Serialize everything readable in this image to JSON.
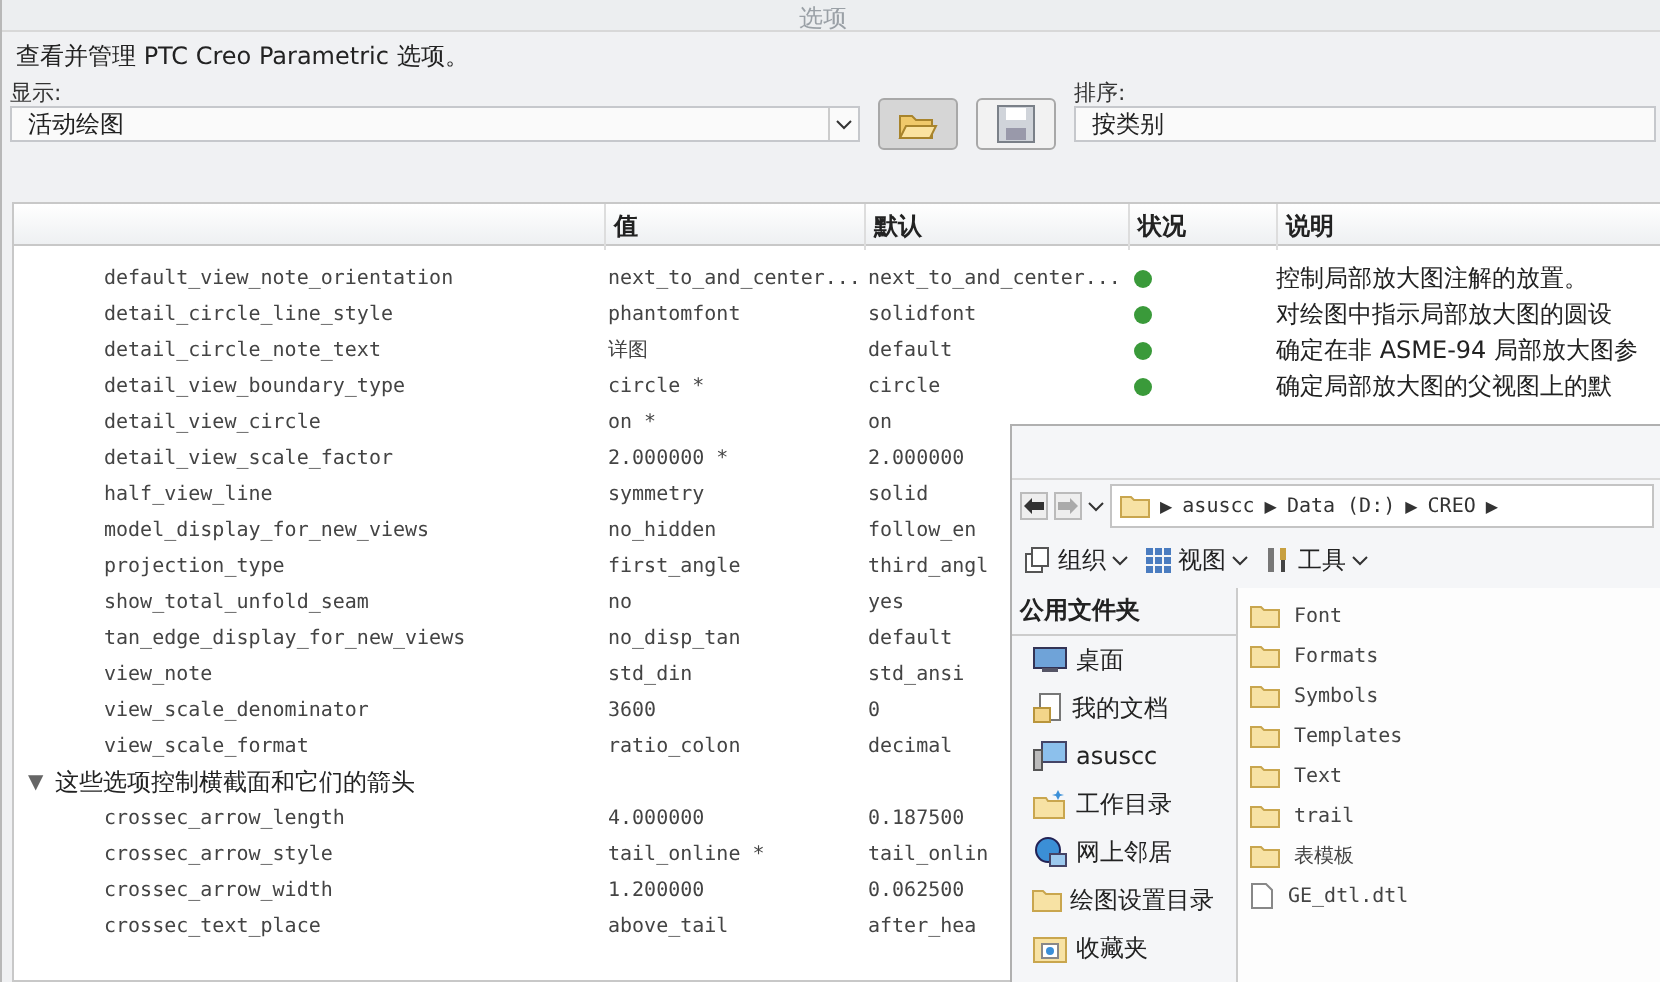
{
  "window": {
    "title": "选项"
  },
  "intro": "查看并管理 PTC Creo Parametric 选项。",
  "show": {
    "label": "显示:",
    "value": "活动绘图"
  },
  "sort": {
    "label": "排序:",
    "value": "按类别"
  },
  "table": {
    "columns": [
      "值",
      "默认",
      "状况",
      "说明"
    ],
    "rows": [
      {
        "kind": "option",
        "name": "default_view_note_orientation",
        "value": "next_to_and_center...",
        "default": "next_to_and_center...",
        "status": true,
        "description": "控制局部放大图注解的放置。"
      },
      {
        "kind": "option",
        "name": "detail_circle_line_style",
        "value": "phantomfont",
        "default": "solidfont",
        "status": true,
        "description": "对绘图中指示局部放大图的圆设"
      },
      {
        "kind": "option",
        "name": "detail_circle_note_text",
        "value": "详图",
        "default": "default",
        "status": true,
        "description": "确定在非 ASME-94 局部放大图参"
      },
      {
        "kind": "option",
        "name": "detail_view_boundary_type",
        "value": "circle *",
        "default": "circle",
        "status": true,
        "description": "确定局部放大图的父视图上的默"
      },
      {
        "kind": "option",
        "name": "detail_view_circle",
        "value": "on *",
        "default": "on"
      },
      {
        "kind": "option",
        "name": "detail_view_scale_factor",
        "value": "2.000000 *",
        "default": "2.000000"
      },
      {
        "kind": "option",
        "name": "half_view_line",
        "value": "symmetry",
        "default": "solid"
      },
      {
        "kind": "option",
        "name": "model_display_for_new_views",
        "value": "no_hidden",
        "default": "follow_en"
      },
      {
        "kind": "option",
        "name": "projection_type",
        "value": "first_angle",
        "default": "third_angl"
      },
      {
        "kind": "option",
        "name": "show_total_unfold_seam",
        "value": "no",
        "default": "yes"
      },
      {
        "kind": "option",
        "name": "tan_edge_display_for_new_views",
        "value": "no_disp_tan",
        "default": "default"
      },
      {
        "kind": "option",
        "name": "view_note",
        "value": "std_din",
        "default": "std_ansi"
      },
      {
        "kind": "option",
        "name": "view_scale_denominator",
        "value": "3600",
        "default": "0"
      },
      {
        "kind": "option",
        "name": "view_scale_format",
        "value": "ratio_colon",
        "default": "decimal"
      },
      {
        "kind": "group",
        "toggle": "▼",
        "name": "这些选项控制横截面和它们的箭头",
        "expanded": true
      },
      {
        "kind": "option",
        "name": "crossec_arrow_length",
        "value": "4.000000",
        "default": "0.187500"
      },
      {
        "kind": "option",
        "name": "crossec_arrow_style",
        "value": "tail_online *",
        "default": "tail_onlin"
      },
      {
        "kind": "option",
        "name": "crossec_arrow_width",
        "value": "1.200000",
        "default": "0.062500"
      },
      {
        "kind": "option",
        "name": "crossec_text_place",
        "value": "above_tail",
        "default": "after_hea"
      }
    ]
  },
  "file_browser": {
    "path": [
      "asuscc",
      "Data (D:)",
      "CREO"
    ],
    "separator": "▶",
    "toolbar": [
      "组织",
      "视图",
      "工具"
    ],
    "sidebar": {
      "header": "公用文件夹",
      "items": [
        {
          "kind": "desktop",
          "label": "桌面"
        },
        {
          "kind": "docs",
          "label": "我的文档"
        },
        {
          "kind": "computer",
          "label": "asuscc"
        },
        {
          "kind": "workdir",
          "label": "工作目录"
        },
        {
          "kind": "network",
          "label": "网上邻居"
        },
        {
          "kind": "folder",
          "label": "绘图设置目录"
        },
        {
          "kind": "favorites",
          "label": "收藏夹"
        }
      ]
    },
    "files": [
      {
        "kind": "folder",
        "name": "Font"
      },
      {
        "kind": "folder",
        "name": "Formats"
      },
      {
        "kind": "folder",
        "name": "Symbols"
      },
      {
        "kind": "folder",
        "name": "Templates"
      },
      {
        "kind": "folder",
        "name": "Text"
      },
      {
        "kind": "folder",
        "name": "trail"
      },
      {
        "kind": "folder",
        "name": "表模板"
      },
      {
        "kind": "file",
        "name": "GE_dtl.dtl"
      }
    ]
  }
}
